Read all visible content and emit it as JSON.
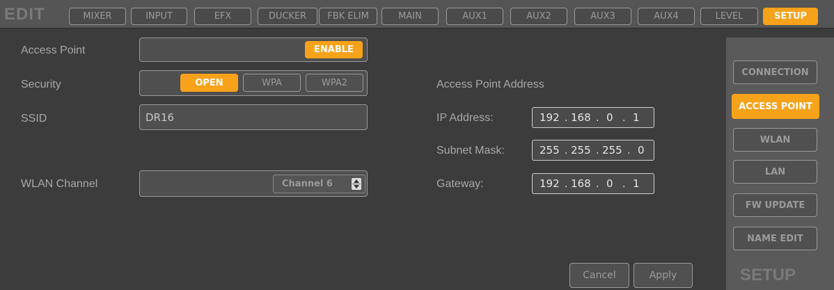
{
  "header": {
    "edit_label": "EDIT",
    "tabs": [
      "MIXER",
      "INPUT",
      "EFX",
      "DUCKER",
      "FBK ELIM",
      "MAIN",
      "AUX1",
      "AUX2",
      "AUX3",
      "AUX4",
      "LEVEL",
      "SETUP"
    ],
    "active_tab": "SETUP"
  },
  "access_point": {
    "label": "Access Point",
    "enable_label": "ENABLE"
  },
  "security": {
    "label": "Security",
    "options": [
      "OPEN",
      "WPA",
      "WPA2"
    ],
    "selected": "OPEN"
  },
  "ssid": {
    "label": "SSID",
    "value": "DR16"
  },
  "wlan_channel": {
    "label": "WLAN Channel",
    "value": "Channel 6"
  },
  "address": {
    "title": "Access Point Address",
    "ip_label": "IP Address:",
    "ip": [
      "192",
      "168",
      "0",
      "1"
    ],
    "subnet_label": "Subnet Mask:",
    "subnet": [
      "255",
      "255",
      "255",
      "0"
    ],
    "gateway_label": "Gateway:",
    "gateway": [
      "192",
      "168",
      "0",
      "1"
    ]
  },
  "actions": {
    "cancel": "Cancel",
    "apply": "Apply"
  },
  "side": {
    "items": [
      "CONNECTION",
      "ACCESS POINT",
      "WLAN",
      "LAN",
      "FW UPDATE",
      "NAME EDIT"
    ],
    "active": "ACCESS POINT",
    "title": "SETUP"
  },
  "colors": {
    "accent": "#f7a21b",
    "background": "#3c3c3c",
    "bar": "#555555"
  }
}
